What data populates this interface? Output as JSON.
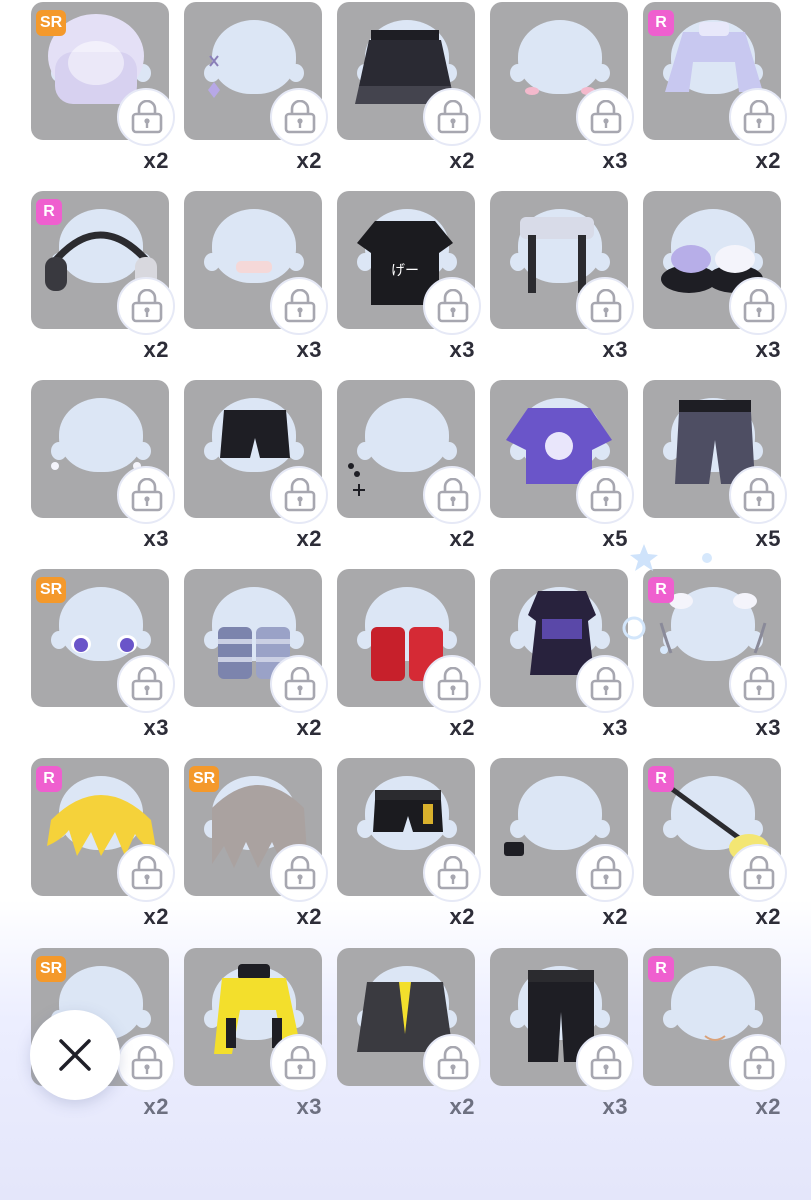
{
  "grid": {
    "rows": [
      [
        {
          "name": "hair-silver-bob",
          "badge": "SR",
          "count": "x2",
          "kind": "hair-silver"
        },
        {
          "name": "earrings-cross",
          "badge": "",
          "count": "x2",
          "kind": "earring"
        },
        {
          "name": "skirt-black-frill",
          "badge": "",
          "count": "x2",
          "kind": "skirt"
        },
        {
          "name": "blush",
          "badge": "",
          "count": "x3",
          "kind": "blush"
        },
        {
          "name": "jacket-lavender",
          "badge": "R",
          "count": "x2",
          "kind": "jacket-lav"
        }
      ],
      [
        {
          "name": "headphones",
          "badge": "R",
          "count": "x2",
          "kind": "headphones"
        },
        {
          "name": "bandage",
          "badge": "",
          "count": "x3",
          "kind": "bandage"
        },
        {
          "name": "tshirt-bunny",
          "badge": "",
          "count": "x3",
          "kind": "tee-black"
        },
        {
          "name": "suspenders",
          "badge": "",
          "count": "x3",
          "kind": "suspenders"
        },
        {
          "name": "bunny-slippers",
          "badge": "",
          "count": "x3",
          "kind": "slippers"
        }
      ],
      [
        {
          "name": "ear-studs",
          "badge": "",
          "count": "x3",
          "kind": "studs"
        },
        {
          "name": "shorts-black",
          "badge": "",
          "count": "x2",
          "kind": "shorts"
        },
        {
          "name": "ear-chain",
          "badge": "",
          "count": "x2",
          "kind": "earchain"
        },
        {
          "name": "tee-purple-smiley",
          "badge": "",
          "count": "x5",
          "kind": "tee-purple"
        },
        {
          "name": "denim-shorts",
          "badge": "",
          "count": "x5",
          "kind": "denim"
        }
      ],
      [
        {
          "name": "eyes-violet",
          "badge": "SR",
          "count": "x3",
          "kind": "eyes"
        },
        {
          "name": "leg-warmers-striped",
          "badge": "",
          "count": "x2",
          "kind": "legwarm-blue"
        },
        {
          "name": "leg-warmers-red",
          "badge": "",
          "count": "x2",
          "kind": "legwarm-red"
        },
        {
          "name": "dress-black-purple",
          "badge": "",
          "count": "x3",
          "kind": "dress"
        },
        {
          "name": "bunny-clips",
          "badge": "R",
          "count": "x3",
          "kind": "clips"
        }
      ],
      [
        {
          "name": "hair-blonde",
          "badge": "R",
          "count": "x2",
          "kind": "hair-blonde"
        },
        {
          "name": "hair-grey-ponytail",
          "badge": "SR",
          "count": "x2",
          "kind": "hair-grey"
        },
        {
          "name": "shorts-chain",
          "badge": "",
          "count": "x2",
          "kind": "shorts2"
        },
        {
          "name": "wristband",
          "badge": "",
          "count": "x2",
          "kind": "wristband"
        },
        {
          "name": "guitar-yellow",
          "badge": "R",
          "count": "x2",
          "kind": "guitar"
        }
      ],
      [
        {
          "name": "glasses",
          "badge": "SR",
          "count": "x2",
          "kind": "plain"
        },
        {
          "name": "jacket-yellow",
          "badge": "",
          "count": "x3",
          "kind": "jacket-yellow"
        },
        {
          "name": "blazer-tie",
          "badge": "",
          "count": "x2",
          "kind": "blazer"
        },
        {
          "name": "pants-lace",
          "badge": "",
          "count": "x3",
          "kind": "pants"
        },
        {
          "name": "mouth-small",
          "badge": "R",
          "count": "x2",
          "kind": "mouth"
        }
      ]
    ]
  },
  "icons": {
    "lock": "lock-icon",
    "close": "close-icon"
  },
  "colors": {
    "tile_bg": "#a9a9ab",
    "badge_sr": "#f4992b",
    "badge_r": "#ef5fcf",
    "count_text": "#2d2d38"
  }
}
